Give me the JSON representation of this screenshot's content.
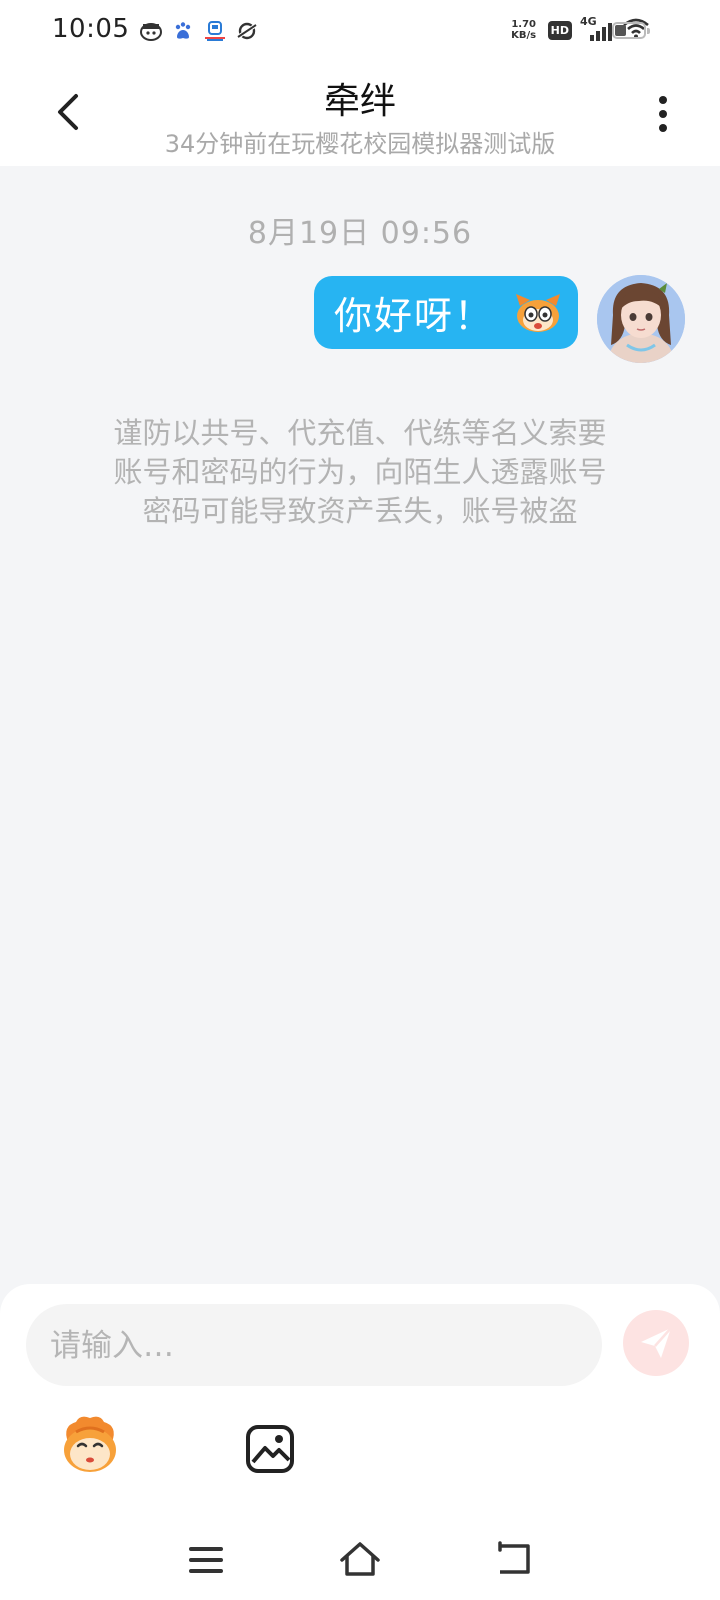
{
  "status_bar": {
    "time": "10:05",
    "app_icons": [
      "cat-face-icon",
      "baidu-paw-icon",
      "train-icon",
      "planet-icon"
    ],
    "net_speed_value": "1.70",
    "net_speed_unit": "KB/s",
    "hd_badge": "HD",
    "network_type": "4G",
    "signal_strength": "4 of 4 bars",
    "wifi": "wifi-icon",
    "battery_level": 0.4
  },
  "header": {
    "title": "牵绊",
    "subtitle": "34分钟前在玩樱花校园模拟器测试版",
    "back_icon": "chevron-left-icon",
    "more_icon": "more-vertical-icon"
  },
  "chat": {
    "timestamp": "8月19日  09:56",
    "messages": [
      {
        "from": "me",
        "text": "你好呀！",
        "sticker": "cartoon-face-icon",
        "bubble_color": "#27b4f2"
      }
    ]
  },
  "warning": {
    "lines": [
      "谨防以共号、代充值、代练等名义索要",
      "账号和密码的行为，向陌生人透露账号",
      "密码可能导致资产丢失，账号被盗"
    ]
  },
  "composer": {
    "placeholder": "请输入…",
    "value": "",
    "send_icon": "paper-plane-icon",
    "send_color": "#fde3e2",
    "emoji_button_icon": "emoji-mascot-icon",
    "image_button_icon": "image-icon"
  },
  "nav_bar": {
    "icons": [
      "menu-icon",
      "home-icon",
      "back-icon"
    ]
  }
}
